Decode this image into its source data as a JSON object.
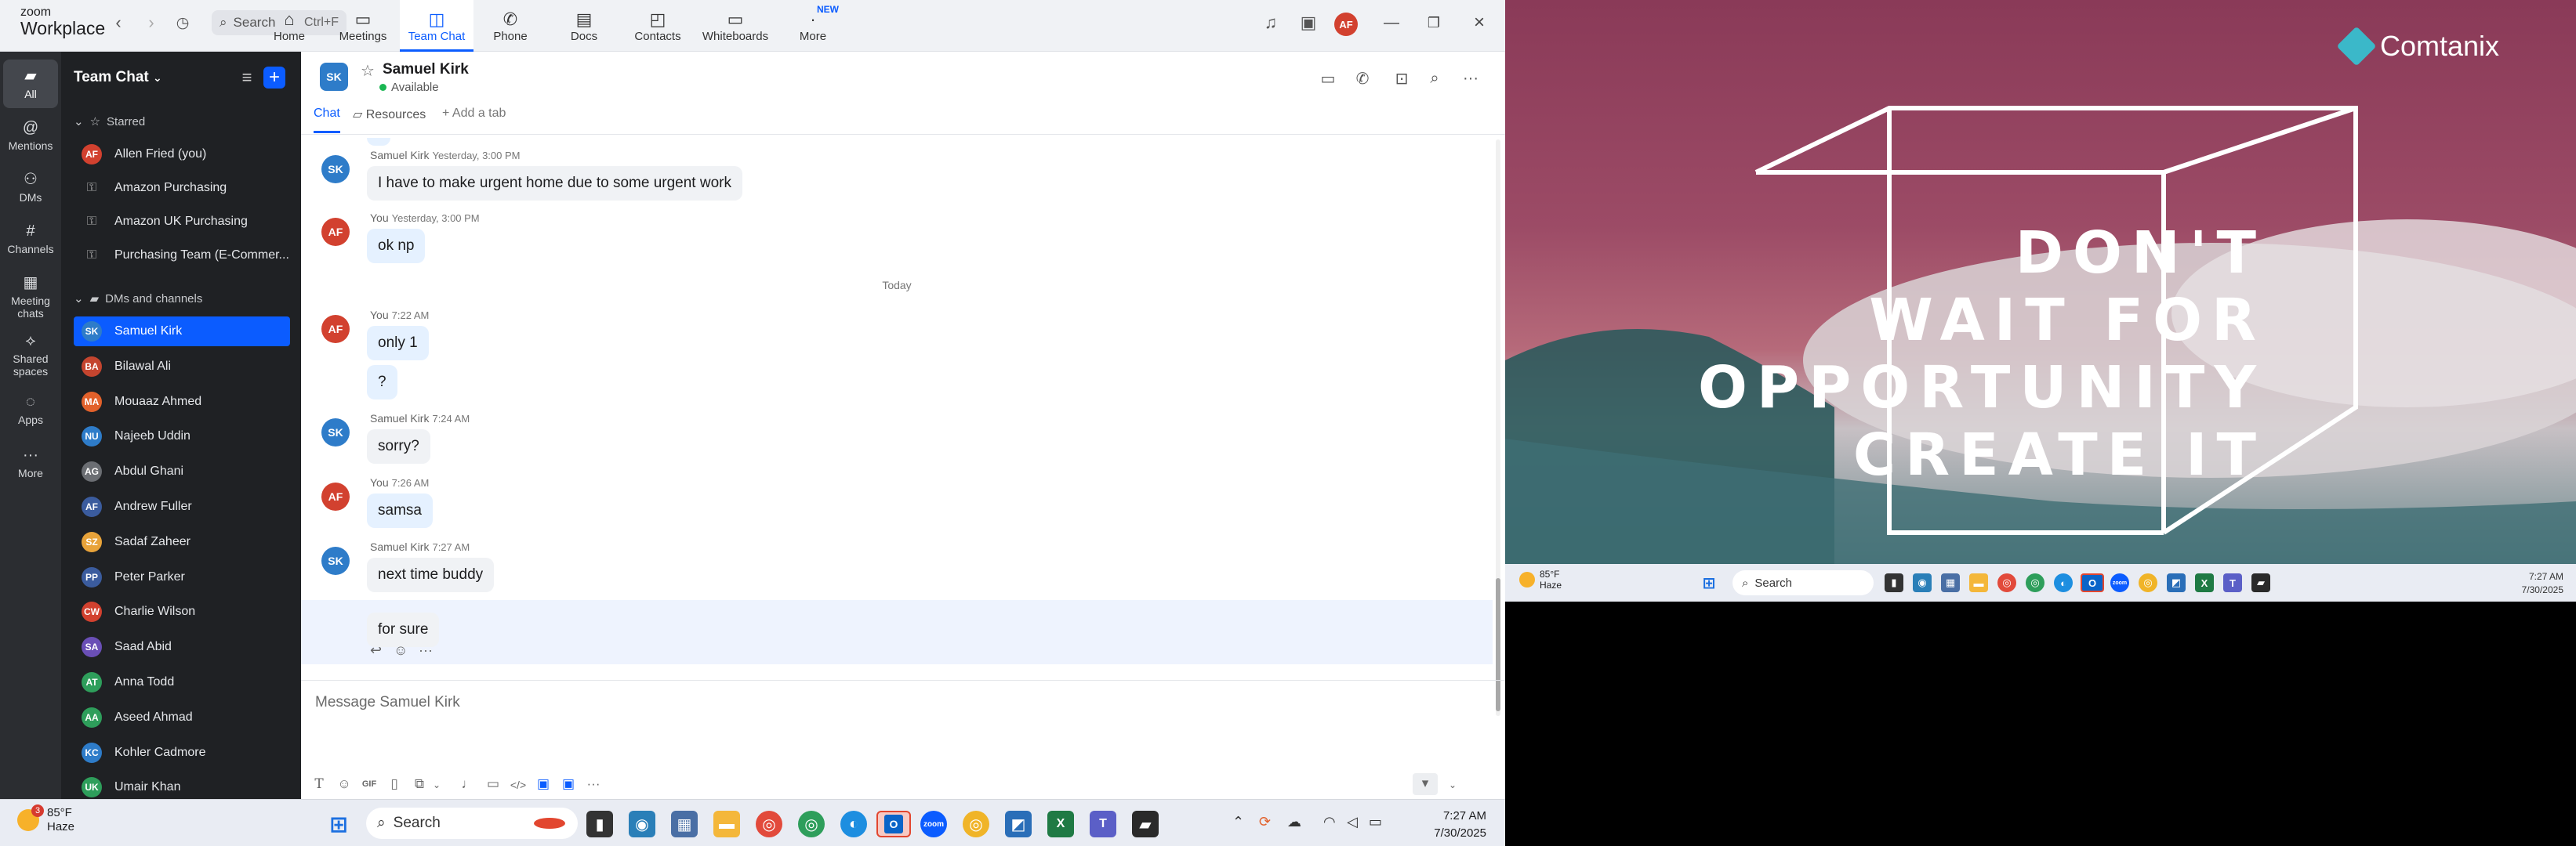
{
  "titlebar": {
    "logo_line1": "zoom",
    "logo_line2": "Workplace",
    "search_label": "Search",
    "search_shortcut": "Ctrl+F",
    "tabs": [
      {
        "label": "Home",
        "icon": "home-icon"
      },
      {
        "label": "Meetings",
        "icon": "video-icon"
      },
      {
        "label": "Team Chat",
        "icon": "chat-icon"
      },
      {
        "label": "Phone",
        "icon": "phone-icon"
      },
      {
        "label": "Docs",
        "icon": "docs-icon"
      },
      {
        "label": "Contacts",
        "icon": "contacts-icon"
      },
      {
        "label": "Whiteboards",
        "icon": "whiteboard-icon"
      },
      {
        "label": "More",
        "icon": "more-icon"
      }
    ],
    "active_tab": "Team Chat",
    "more_badge": "NEW",
    "user_initials": "AF"
  },
  "rail": [
    {
      "label": "All",
      "icon": "chat-bubble-icon"
    },
    {
      "label": "Mentions",
      "icon": "at-icon"
    },
    {
      "label": "DMs",
      "icon": "people-icon"
    },
    {
      "label": "Channels",
      "icon": "hash-icon"
    },
    {
      "label": "Meeting chats",
      "icon": "calendar-icon"
    },
    {
      "label": "Shared spaces",
      "icon": "shared-icon"
    },
    {
      "label": "Apps",
      "icon": "apps-icon"
    },
    {
      "label": "More",
      "icon": "more-icon"
    }
  ],
  "sidebar": {
    "title": "Team Chat",
    "starred_label": "Starred",
    "starred": [
      {
        "name": "Allen Fried (you)",
        "initials": "AF",
        "color": "#d2412f"
      },
      {
        "name": "Amazon Purchasing",
        "locked": true
      },
      {
        "name": "Amazon UK Purchasing",
        "locked": true
      },
      {
        "name": "Purchasing Team (E-Commer...",
        "locked": true
      }
    ],
    "dms_label": "DMs and channels",
    "dms": [
      {
        "name": "Samuel Kirk",
        "initials": "SK",
        "color": "#2e7cc9"
      },
      {
        "name": "Bilawal Ali",
        "initials": "BA",
        "color": "#c4452f"
      },
      {
        "name": "Mouaaz Ahmed",
        "initials": "MA",
        "color": "#e2612b"
      },
      {
        "name": "Najeeb Uddin",
        "initials": "NU",
        "color": "#2e7cc9"
      },
      {
        "name": "Abdul Ghani",
        "initials": "AG",
        "color": "#6b6e73"
      },
      {
        "name": "Andrew Fuller",
        "initials": "AF",
        "color": "#3b5c9e"
      },
      {
        "name": "Sadaf Zaheer",
        "initials": "SZ",
        "color": "#e8a33a"
      },
      {
        "name": "Peter Parker",
        "initials": "PP",
        "color": "#3b5c9e"
      },
      {
        "name": "Charlie Wilson",
        "initials": "CW",
        "color": "#d2412f"
      },
      {
        "name": "Saad Abid",
        "initials": "SA",
        "color": "#6a4fb6"
      },
      {
        "name": "Anna Todd",
        "initials": "AT",
        "color": "#2e9e5b"
      },
      {
        "name": "Aseed Ahmad",
        "initials": "AA",
        "color": "#2e9e5b"
      },
      {
        "name": "Kohler Cadmore",
        "initials": "KC",
        "color": "#2e7cc9"
      },
      {
        "name": "Umair Khan",
        "initials": "UK",
        "color": "#2e9e5b"
      }
    ]
  },
  "chat": {
    "contact_name": "Samuel Kirk",
    "contact_initials": "SK",
    "status": "Available",
    "tabs": [
      "Chat",
      "Resources",
      "+ Add a tab"
    ],
    "today_label": "Today",
    "messages": [
      {
        "sender": "Samuel Kirk",
        "time": "Yesterday, 3:00 PM",
        "text": "I have to make urgent home due to some urgent work",
        "initials": "SK",
        "me": false
      },
      {
        "sender": "You",
        "time": "Yesterday, 3:00 PM",
        "text": "ok np",
        "initials": "AF",
        "me": true
      },
      {
        "sender": "You",
        "time": "7:22 AM",
        "text": "only 1",
        "initials": "AF",
        "me": true
      },
      {
        "sender": "",
        "time": "",
        "text": "?",
        "initials": "",
        "me": true
      },
      {
        "sender": "Samuel Kirk",
        "time": "7:24 AM",
        "text": "sorry?",
        "initials": "SK",
        "me": false
      },
      {
        "sender": "You",
        "time": "7:26 AM",
        "text": "samsa",
        "initials": "AF",
        "me": true
      },
      {
        "sender": "Samuel Kirk",
        "time": "7:27 AM",
        "text": "next time buddy",
        "initials": "SK",
        "me": false
      },
      {
        "sender": "",
        "time": "",
        "text": "for sure",
        "initials": "",
        "me": false
      }
    ],
    "composer_placeholder": "Message Samuel Kirk",
    "gif_label": "GIF"
  },
  "taskbar_left": {
    "temp": "85°F",
    "condition": "Haze",
    "badge": "3",
    "search_label": "Search",
    "time": "7:27 AM",
    "date": "7/30/2025"
  },
  "wallpaper": {
    "brand": "Comtanix",
    "lines": [
      "DON'T",
      "WAIT FOR",
      "OPPORTUNITY",
      "CREATE IT"
    ]
  },
  "taskbar_right": {
    "temp": "85°F",
    "condition": "Haze",
    "search_label": "Search",
    "time": "7:27 AM",
    "date": "7/30/2025"
  },
  "colors": {
    "accent": "#0b5cff",
    "sidebar_bg": "#1f2124",
    "rail_bg": "#2b2d31"
  }
}
